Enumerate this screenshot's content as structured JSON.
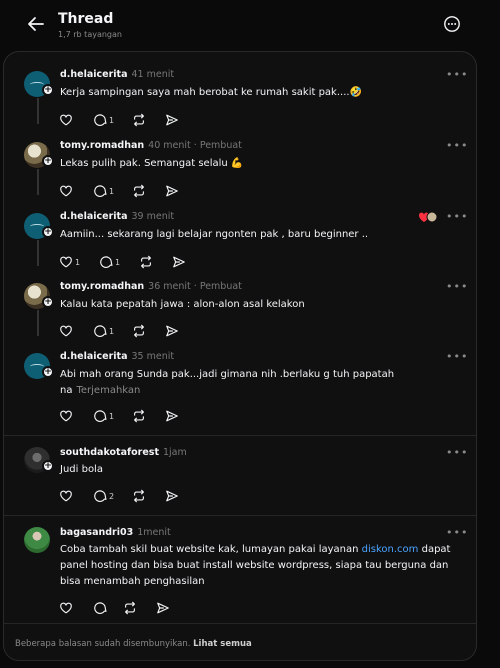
{
  "header": {
    "title": "Thread",
    "views": "1,7 rb tayangan"
  },
  "posts": [
    {
      "username": "d.helaicerita",
      "time": "41 menit",
      "author_tag": "",
      "text": "Kerja sampingan saya mah berobat ke rumah sakit pak....🤣",
      "likes": "",
      "replies": "1",
      "avatar": "teal"
    },
    {
      "username": "tomy.romadhan",
      "time": "40 menit",
      "author_tag": "· Pembuat",
      "text": "Lekas pulih pak. Semangat selalu 💪",
      "likes": "",
      "replies": "1",
      "avatar": "photo"
    },
    {
      "username": "d.helaicerita",
      "time": "39 menit",
      "author_tag": "",
      "text": "Aamiin... sekarang lagi belajar ngonten pak , baru beginner ..",
      "likes": "1",
      "replies": "1",
      "avatar": "teal"
    },
    {
      "username": "tomy.romadhan",
      "time": "36 menit",
      "author_tag": "· Pembuat",
      "text": "Kalau kata pepatah jawa : alon-alon asal kelakon",
      "likes": "",
      "replies": "1",
      "avatar": "photo"
    },
    {
      "username": "d.helaicerita",
      "time": "35 menit",
      "author_tag": "",
      "text": "Abi mah orang Sunda pak...jadi gimana nih .berlaku g tuh papatah na",
      "translate": "Terjemahkan",
      "likes": "",
      "replies": "1",
      "avatar": "teal"
    },
    {
      "username": "southdakotaforest",
      "time": "1jam",
      "author_tag": "",
      "text": "Judi bola",
      "likes": "",
      "replies": "2",
      "avatar": "dark"
    },
    {
      "username": "bagasandri03",
      "time": "1menit",
      "author_tag": "",
      "text_before": "Coba tambah skil buat website kak, lumayan pakai layanan ",
      "link": "diskon.com",
      "text_after": " dapat panel hosting dan bisa buat install website wordpress, siapa tau berguna dan bisa menambah penghasilan",
      "likes": "",
      "replies": "",
      "avatar": "field"
    }
  ],
  "footer": {
    "text": "Beberapa balasan sudah disembunyikan.",
    "link": "Lihat semua"
  },
  "icons": {
    "back": "arrow-left-icon",
    "more": "more-circle-icon",
    "like": "heart-icon",
    "reply": "comment-icon",
    "repost": "repost-icon",
    "share": "send-icon"
  }
}
